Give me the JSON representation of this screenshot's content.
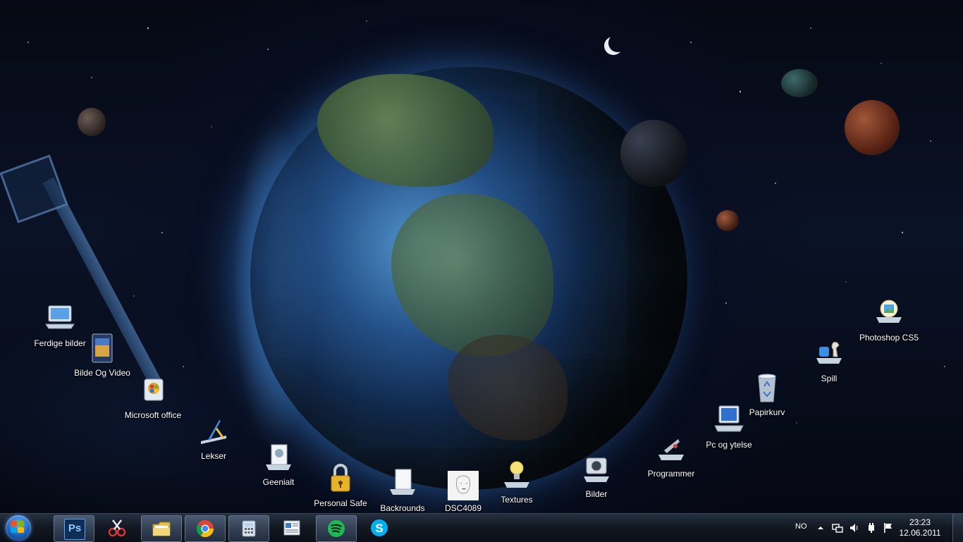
{
  "desktop": {
    "icons": [
      {
        "label": "Ferdige bilder",
        "icon": "laptop-icon"
      },
      {
        "label": "Bilde Og Video",
        "icon": "film-icon"
      },
      {
        "label": "Microsoft office",
        "icon": "office-icon"
      },
      {
        "label": "Lekser",
        "icon": "drafting-icon"
      },
      {
        "label": "Geenialt",
        "icon": "media-icon"
      },
      {
        "label": "Personal Safe",
        "icon": "padlock-icon"
      },
      {
        "label": "Backrounds",
        "icon": "picture-frame-icon"
      },
      {
        "label": "DSC4089",
        "icon": "sketch-thumbnail-icon"
      },
      {
        "label": "Textures",
        "icon": "light-bulb-icon"
      },
      {
        "label": "Bilder",
        "icon": "camera-icon"
      },
      {
        "label": "Programmer",
        "icon": "tools-icon"
      },
      {
        "label": "Pc og ytelse",
        "icon": "computer-icon"
      },
      {
        "label": "Papirkurv",
        "icon": "recycle-bin-icon"
      },
      {
        "label": "Spill",
        "icon": "chess-puzzle-icon"
      },
      {
        "label": "Photoshop CS5",
        "icon": "photoshop-shortcut-icon"
      }
    ]
  },
  "taskbar": {
    "start": {
      "icon": "windows-logo-icon"
    },
    "buttons": [
      {
        "app": "Photoshop",
        "icon": "photoshop-icon",
        "text": "Ps"
      },
      {
        "app": "Snipping Tool",
        "icon": "scissors-icon"
      },
      {
        "app": "Windows Explorer",
        "icon": "folder-icon"
      },
      {
        "app": "Google Chrome",
        "icon": "chrome-icon"
      },
      {
        "app": "Calculator",
        "icon": "calculator-icon"
      },
      {
        "app": "Document",
        "icon": "document-icon"
      },
      {
        "app": "Spotify",
        "icon": "spotify-icon"
      },
      {
        "app": "Skype",
        "icon": "skype-icon"
      }
    ],
    "tray": {
      "language": "NO",
      "time": "23:23",
      "date": "12.06.2011"
    }
  },
  "colors": {
    "taskbar": "#121a26",
    "accent": "#1d5fb8",
    "spotify": "#1db954",
    "skype": "#00aff0",
    "photoshop": "#1b4f8a"
  }
}
